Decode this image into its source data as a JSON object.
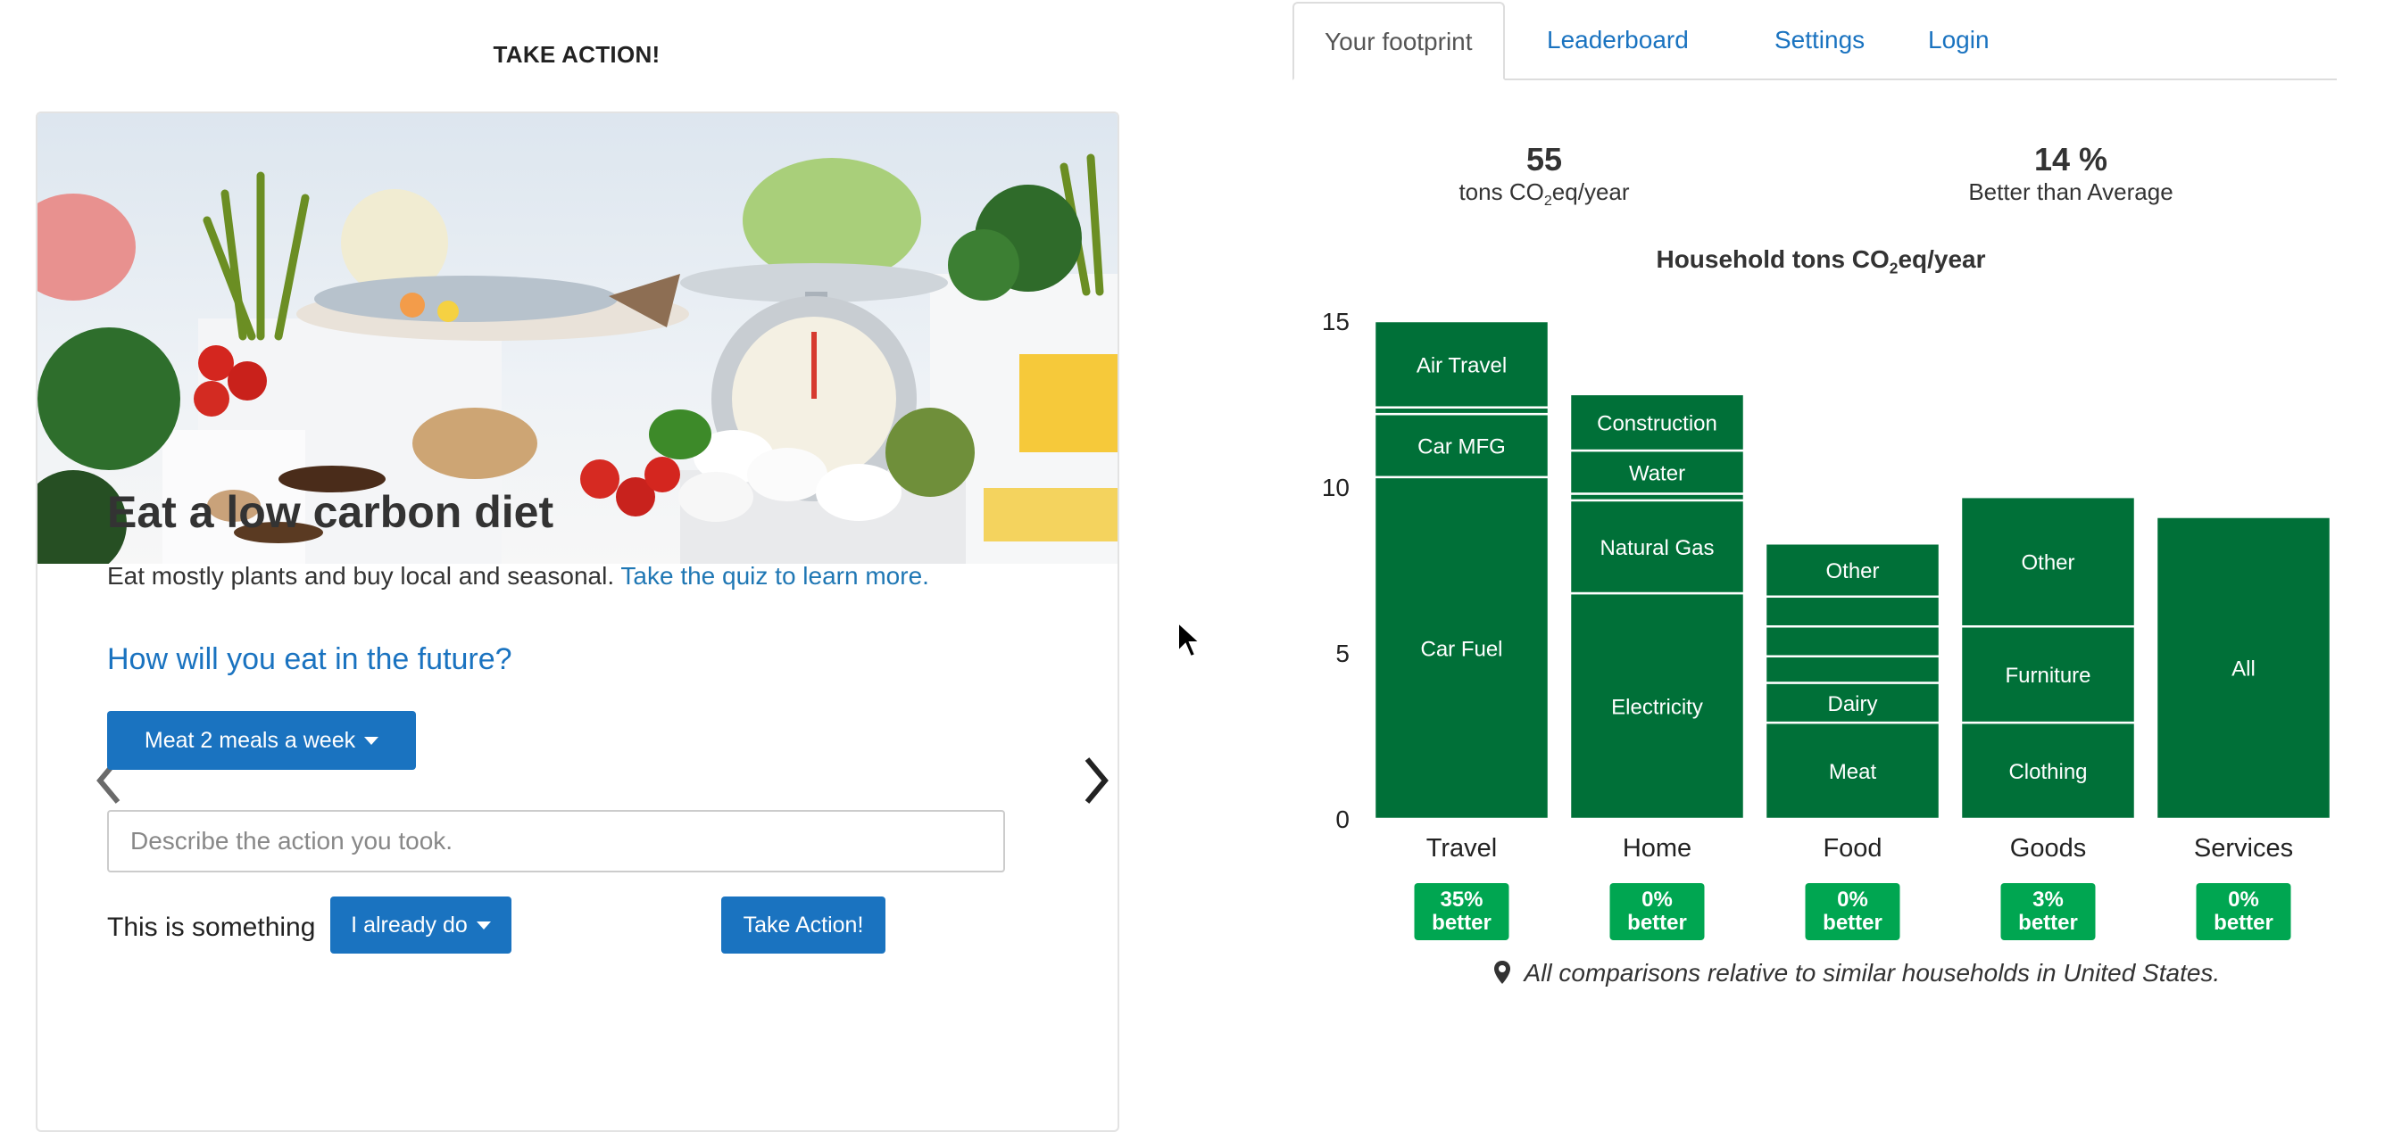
{
  "left_panel": {
    "header": "TAKE ACTION!",
    "action": {
      "title": "Eat a low carbon diet",
      "description": "Eat mostly plants and buy local and seasonal.",
      "quiz_link": "Take the quiz to learn more.",
      "question": "How will you eat in the future?",
      "meat_dropdown": "Meat 2 meals a week",
      "describe_placeholder": "Describe the action you took.",
      "something_label": "This is something",
      "already_dropdown": "I already do",
      "take_action_button": "Take Action!"
    }
  },
  "right_panel": {
    "tabs": [
      "Your footprint",
      "Leaderboard",
      "Settings",
      "Login"
    ],
    "active_tab": "Your footprint",
    "stats": {
      "total_value": "55",
      "total_unit_prefix": "tons CO",
      "total_unit_sub": "2",
      "total_unit_suffix": "eq/year",
      "compare_value": "14 %",
      "compare_label": "Better than Average"
    },
    "chart_title_prefix": "Household tons CO",
    "chart_title_sub": "2",
    "chart_title_suffix": "eq/year",
    "footnote": "All comparisons relative to similar households in United States."
  },
  "chart_data": {
    "type": "bar",
    "stacked": true,
    "color": "#007038",
    "badge_color": "#00a651",
    "ylim": [
      0,
      15
    ],
    "yticks": [
      0,
      5,
      10,
      15
    ],
    "categories": [
      "Travel",
      "Home",
      "Food",
      "Goods",
      "Services"
    ],
    "segments": [
      [
        {
          "label": "Car Fuel",
          "value": 10.3
        },
        {
          "label": "Car MFG",
          "value": 1.9
        },
        {
          "label": "",
          "value": 0.2
        },
        {
          "label": "Air Travel",
          "value": 2.6
        }
      ],
      [
        {
          "label": "Electricity",
          "value": 6.8
        },
        {
          "label": "Natural Gas",
          "value": 2.8
        },
        {
          "label": "",
          "value": 0.2
        },
        {
          "label": "Water",
          "value": 1.3
        },
        {
          "label": "Construction",
          "value": 1.7
        }
      ],
      [
        {
          "label": "Meat",
          "value": 2.9
        },
        {
          "label": "Dairy",
          "value": 1.2
        },
        {
          "label": "",
          "value": 0.8
        },
        {
          "label": "",
          "value": 0.9
        },
        {
          "label": "",
          "value": 0.9
        },
        {
          "label": "Other",
          "value": 1.6
        }
      ],
      [
        {
          "label": "Clothing",
          "value": 2.9
        },
        {
          "label": "Furniture",
          "value": 2.9
        },
        {
          "label": "Other",
          "value": 3.9
        }
      ],
      [
        {
          "label": "All",
          "value": 9.1
        }
      ]
    ],
    "badges": [
      "35%\nbetter",
      "0%\nbetter",
      "0%\nbetter",
      "3%\nbetter",
      "0%\nbetter"
    ]
  }
}
